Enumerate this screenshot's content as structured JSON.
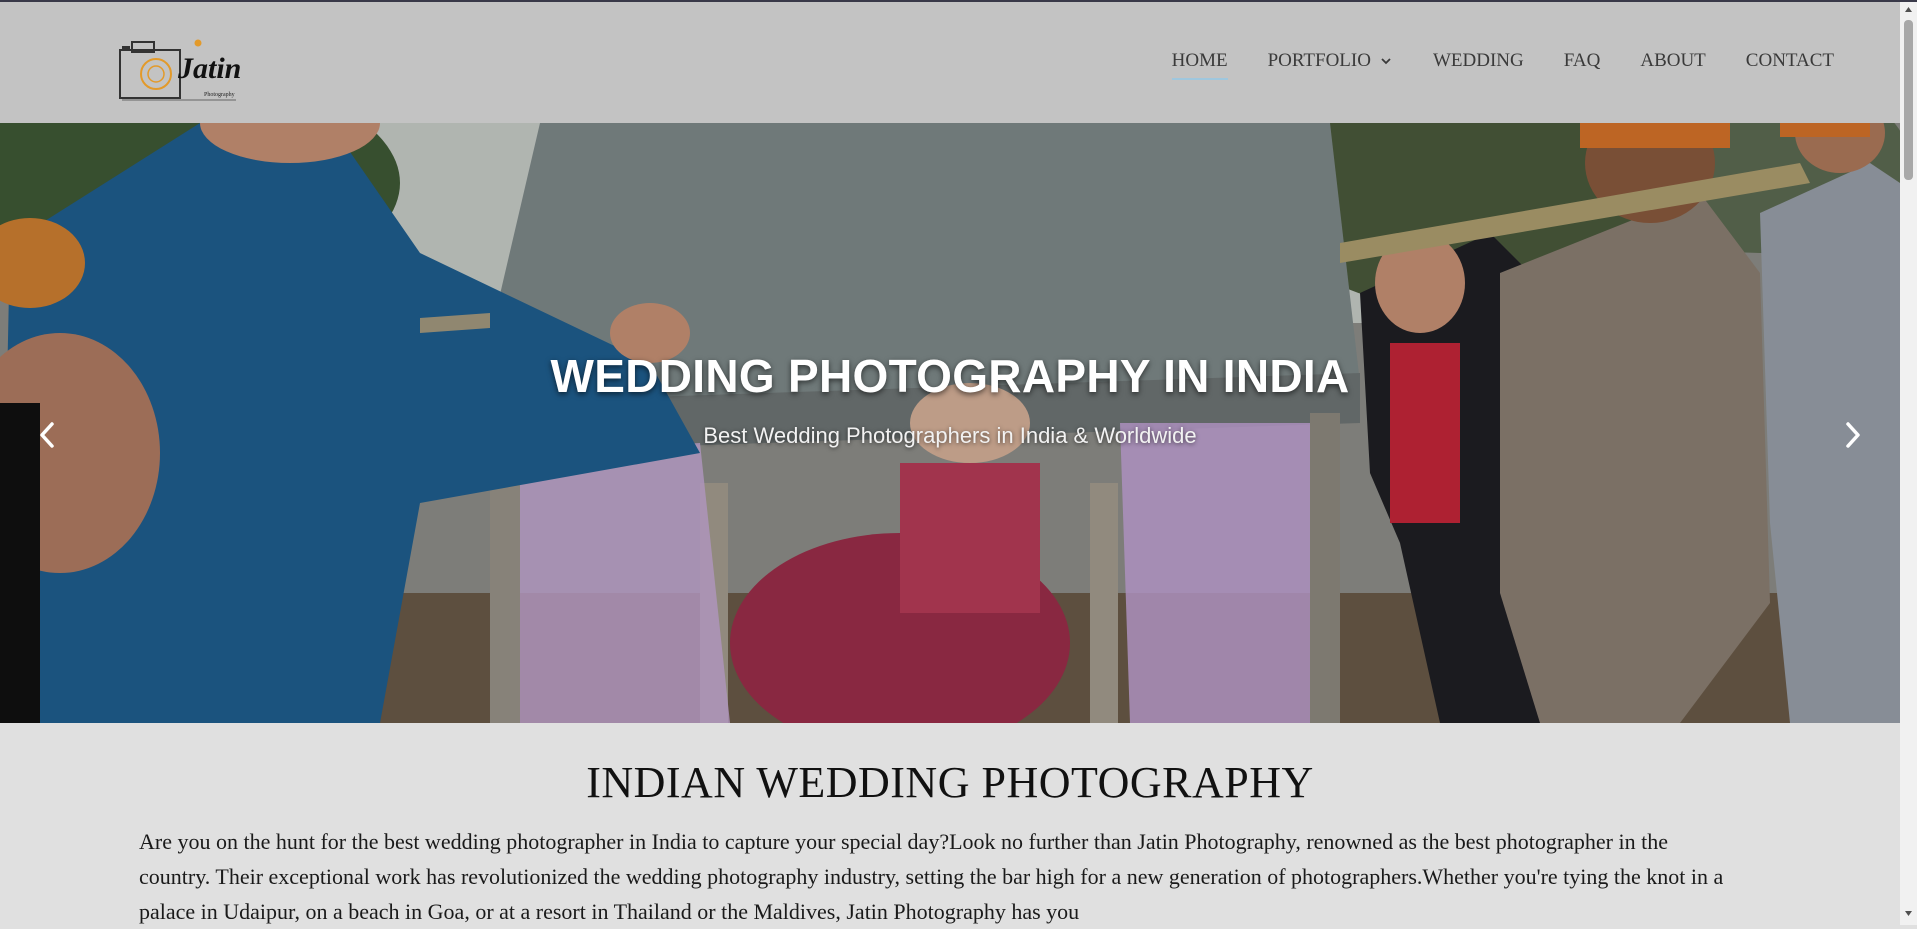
{
  "brand": {
    "logo_text": "Jatin",
    "logo_subtext": "Photography"
  },
  "nav": {
    "items": [
      {
        "label": "HOME",
        "active": true
      },
      {
        "label": "PORTFOLIO",
        "has_dropdown": true
      },
      {
        "label": "WEDDING"
      },
      {
        "label": "FAQ"
      },
      {
        "label": "ABOUT"
      },
      {
        "label": "CONTACT"
      }
    ]
  },
  "hero": {
    "title": "WEDDING PHOTOGRAPHY IN INDIA",
    "subtitle": "Best Wedding Photographers in India & Worldwide",
    "prev_icon": "chevron-left-icon",
    "next_icon": "chevron-right-icon"
  },
  "content": {
    "heading": "INDIAN WEDDING PHOTOGRAPHY",
    "paragraph": "Are you on the hunt for the best wedding photographer in India to capture your special day?Look no further than Jatin Photography, renowned as the best photographer in the country. Their exceptional work has revolutionized the wedding photography industry, setting the bar high for a new generation of photographers.Whether you're tying the knot in a palace in Udaipur, on a beach in Goa, or at a resort in Thailand or the Maldives, Jatin Photography has you"
  },
  "colors": {
    "header_bg": "#c3c3c3",
    "page_bg": "#e0e0e0",
    "active_underline": "#9fc7de",
    "logo_accent": "#e39a2a"
  }
}
